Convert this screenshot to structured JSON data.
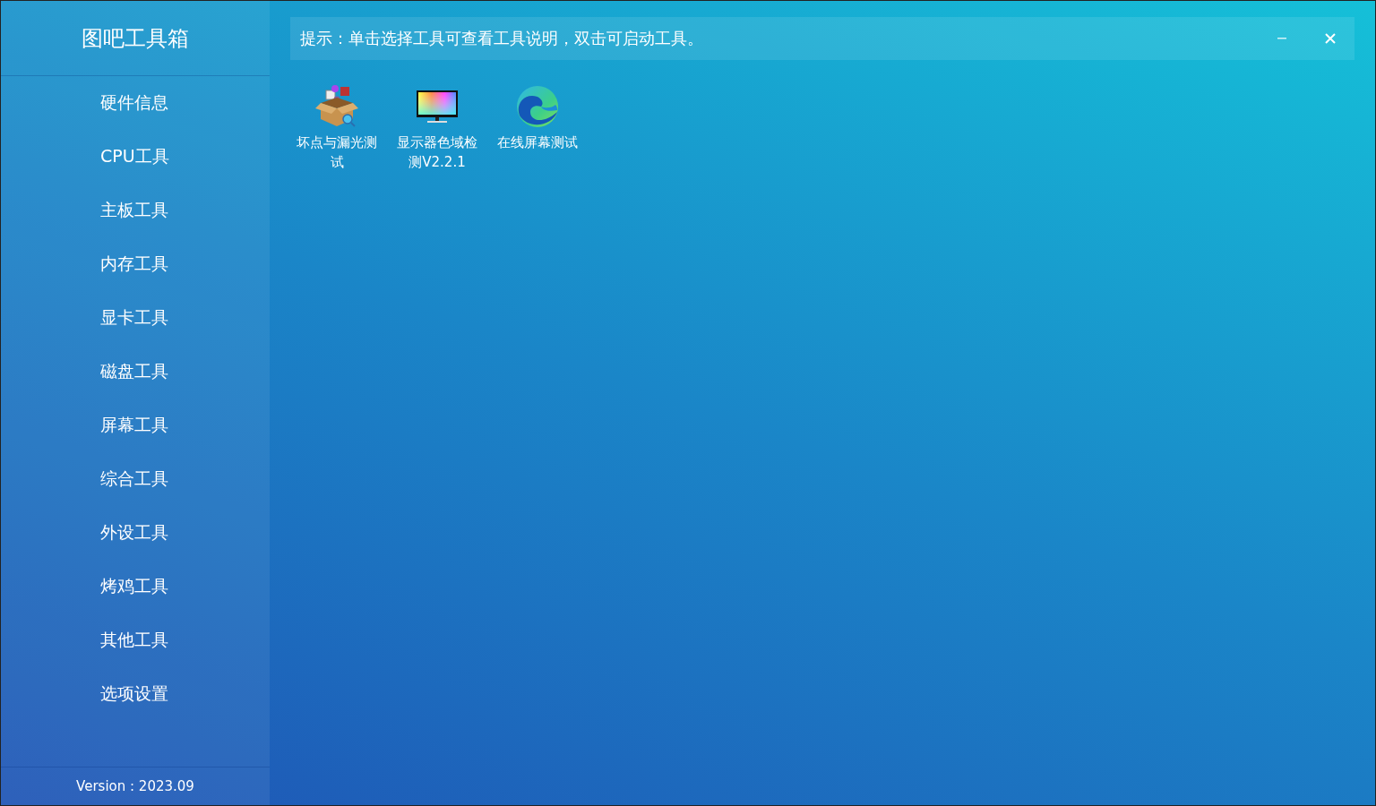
{
  "sidebar": {
    "title": "图吧工具箱",
    "items": [
      "硬件信息",
      "CPU工具",
      "主板工具",
      "内存工具",
      "显卡工具",
      "磁盘工具",
      "屏幕工具",
      "综合工具",
      "外设工具",
      "烤鸡工具",
      "其他工具",
      "选项设置"
    ],
    "version": "Version : 2023.09"
  },
  "hint_bar": {
    "text": "提示：单击选择工具可查看工具说明，双击可启动工具。"
  },
  "tools": [
    {
      "kind": "box",
      "label": "坏点与漏光测试"
    },
    {
      "kind": "monitor",
      "label": "显示器色域检测V2.2.1"
    },
    {
      "kind": "swirl",
      "label": "在线屏幕测试"
    }
  ]
}
